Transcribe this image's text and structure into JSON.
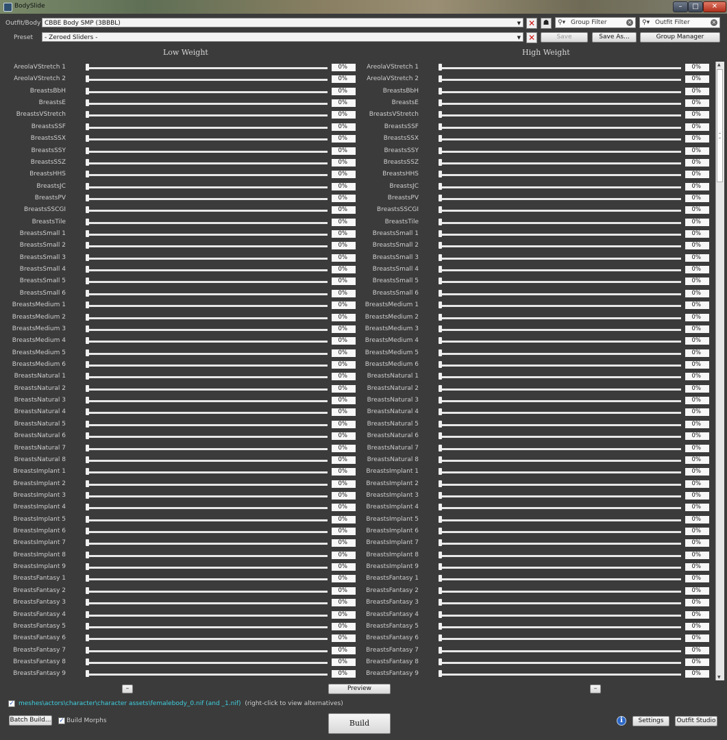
{
  "window": {
    "title": "BodySlide",
    "minimize": "–",
    "maximize": "□",
    "close": "✕"
  },
  "toolbar": {
    "outfit_label": "Outfit/Body",
    "outfit_value": "CBBE Body SMP (3BBBL)",
    "preset_label": "Preset",
    "preset_value": "- Zeroed Sliders -",
    "group_filter_placeholder": "Group Filter",
    "outfit_filter_placeholder": "Outfit Filter",
    "save_label": "Save",
    "save_as_label": "Save As...",
    "group_manager_label": "Group Manager",
    "clear_icon": "x-icon",
    "search_icon": "search-icon",
    "choose_outfit_icon": "user-icon"
  },
  "columns": {
    "low_header": "Low Weight",
    "high_header": "High Weight"
  },
  "sliders": [
    {
      "name": "AreolaVStretch  1",
      "low": "0%",
      "high": "0%"
    },
    {
      "name": "AreolaVStretch  2",
      "low": "0%",
      "high": "0%"
    },
    {
      "name": "BreastsBbH",
      "low": "0%",
      "high": "0%"
    },
    {
      "name": "BreastsE",
      "low": "0%",
      "high": "0%"
    },
    {
      "name": "BreastsVStretch",
      "low": "0%",
      "high": "0%"
    },
    {
      "name": "BreastsSSF",
      "low": "0%",
      "high": "0%"
    },
    {
      "name": "BreastsSSX",
      "low": "0%",
      "high": "0%"
    },
    {
      "name": "BreastsSSY",
      "low": "0%",
      "high": "0%"
    },
    {
      "name": "BreastsSSZ",
      "low": "0%",
      "high": "0%"
    },
    {
      "name": "BreastsHHS",
      "low": "0%",
      "high": "0%"
    },
    {
      "name": "BreastsJC",
      "low": "0%",
      "high": "0%"
    },
    {
      "name": "BreastsPV",
      "low": "0%",
      "high": "0%"
    },
    {
      "name": "BreastsSSCGI",
      "low": "0%",
      "high": "0%"
    },
    {
      "name": "BreastsTile",
      "low": "0%",
      "high": "0%"
    },
    {
      "name": "BreastsSmall  1",
      "low": "0%",
      "high": "0%"
    },
    {
      "name": "BreastsSmall  2",
      "low": "0%",
      "high": "0%"
    },
    {
      "name": "BreastsSmall  3",
      "low": "0%",
      "high": "0%"
    },
    {
      "name": "BreastsSmall  4",
      "low": "0%",
      "high": "0%"
    },
    {
      "name": "BreastsSmall  5",
      "low": "0%",
      "high": "0%"
    },
    {
      "name": "BreastsSmall  6",
      "low": "0%",
      "high": "0%"
    },
    {
      "name": "BreastsMedium  1",
      "low": "0%",
      "high": "0%"
    },
    {
      "name": "BreastsMedium  2",
      "low": "0%",
      "high": "0%"
    },
    {
      "name": "BreastsMedium  3",
      "low": "0%",
      "high": "0%"
    },
    {
      "name": "BreastsMedium  4",
      "low": "0%",
      "high": "0%"
    },
    {
      "name": "BreastsMedium  5",
      "low": "0%",
      "high": "0%"
    },
    {
      "name": "BreastsMedium  6",
      "low": "0%",
      "high": "0%"
    },
    {
      "name": "BreastsNatural  1",
      "low": "0%",
      "high": "0%"
    },
    {
      "name": "BreastsNatural  2",
      "low": "0%",
      "high": "0%"
    },
    {
      "name": "BreastsNatural  3",
      "low": "0%",
      "high": "0%"
    },
    {
      "name": "BreastsNatural  4",
      "low": "0%",
      "high": "0%"
    },
    {
      "name": "BreastsNatural  5",
      "low": "0%",
      "high": "0%"
    },
    {
      "name": "BreastsNatural  6",
      "low": "0%",
      "high": "0%"
    },
    {
      "name": "BreastsNatural  7",
      "low": "0%",
      "high": "0%"
    },
    {
      "name": "BreastsNatural  8",
      "low": "0%",
      "high": "0%"
    },
    {
      "name": "BreastsImplant  1",
      "low": "0%",
      "high": "0%"
    },
    {
      "name": "BreastsImplant  2",
      "low": "0%",
      "high": "0%"
    },
    {
      "name": "BreastsImplant  3",
      "low": "0%",
      "high": "0%"
    },
    {
      "name": "BreastsImplant  4",
      "low": "0%",
      "high": "0%"
    },
    {
      "name": "BreastsImplant  5",
      "low": "0%",
      "high": "0%"
    },
    {
      "name": "BreastsImplant  6",
      "low": "0%",
      "high": "0%"
    },
    {
      "name": "BreastsImplant  7",
      "low": "0%",
      "high": "0%"
    },
    {
      "name": "BreastsImplant  8",
      "low": "0%",
      "high": "0%"
    },
    {
      "name": "BreastsImplant  9",
      "low": "0%",
      "high": "0%"
    },
    {
      "name": "BreastsFantasy  1",
      "low": "0%",
      "high": "0%"
    },
    {
      "name": "BreastsFantasy  2",
      "low": "0%",
      "high": "0%"
    },
    {
      "name": "BreastsFantasy  3",
      "low": "0%",
      "high": "0%"
    },
    {
      "name": "BreastsFantasy  4",
      "low": "0%",
      "high": "0%"
    },
    {
      "name": "BreastsFantasy  5",
      "low": "0%",
      "high": "0%"
    },
    {
      "name": "BreastsFantasy  6",
      "low": "0%",
      "high": "0%"
    },
    {
      "name": "BreastsFantasy  7",
      "low": "0%",
      "high": "0%"
    },
    {
      "name": "BreastsFantasy  8",
      "low": "0%",
      "high": "0%"
    },
    {
      "name": "BreastsFantasy  9",
      "low": "0%",
      "high": "0%"
    }
  ],
  "bottom": {
    "low_minus": "–",
    "high_minus": "–",
    "preview_label": "Preview",
    "output_path": "meshes\\actors\\character\\character assets\\femalebody_0.nif (and _1.nif)",
    "output_hint": "(right-click to view alternatives)",
    "output_checked": "✓",
    "batch_build_label": "Batch Build...",
    "build_morphs_label": "Build Morphs",
    "build_morphs_checked": "✓",
    "build_label": "Build",
    "settings_label": "Settings",
    "outfit_studio_label": "Outfit Studio",
    "info_icon": "i"
  },
  "colors": {
    "path_link": "#3fd0e0",
    "background": "#3b3b3b",
    "close_button": "#c8402a"
  }
}
